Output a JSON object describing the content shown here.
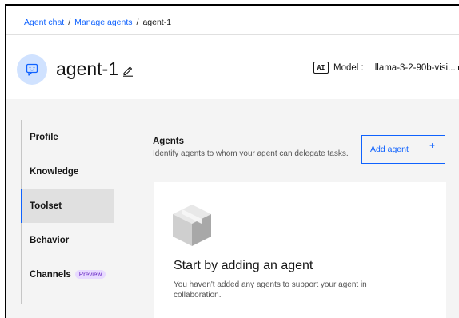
{
  "breadcrumb": {
    "items": [
      "Agent chat",
      "Manage agents"
    ],
    "separator": "/",
    "current": "agent-1"
  },
  "header": {
    "agent_name": "agent-1",
    "model_badge": "AI",
    "model_label": "Model :",
    "model_value": "llama-3-2-90b-visi..."
  },
  "side_nav": {
    "items": [
      {
        "label": "Profile",
        "active": false
      },
      {
        "label": "Knowledge",
        "active": false
      },
      {
        "label": "Toolset",
        "active": true
      },
      {
        "label": "Behavior",
        "active": false
      },
      {
        "label": "Channels",
        "active": false,
        "tag": "Preview"
      }
    ]
  },
  "agents_section": {
    "title": "Agents",
    "description": "Identify agents to whom your agent can delegate tasks.",
    "add_button_label": "Add agent",
    "add_button_icon": "+"
  },
  "empty_state": {
    "title": "Start by adding an agent",
    "description": "You haven't added any agents to support your agent in collaboration."
  },
  "colors": {
    "accent": "#0f62fe",
    "avatar_bg": "#d0e2ff",
    "band_bg": "#f4f4f4",
    "nav_active_bg": "#e0e0e0",
    "preview_tag_bg": "#e8daff",
    "preview_tag_text": "#6929c4"
  }
}
